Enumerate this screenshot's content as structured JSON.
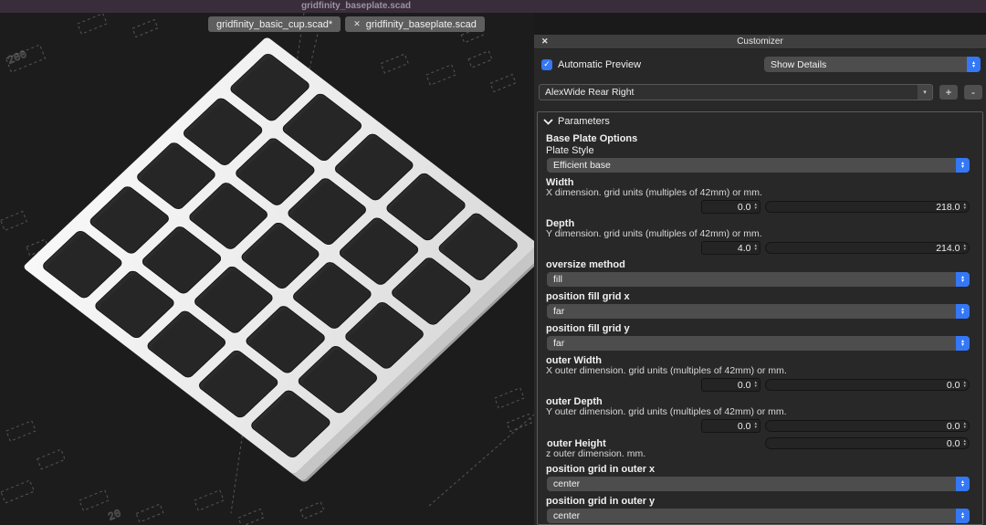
{
  "icons": {
    "close": "✕",
    "check": "✓",
    "chevron_up": "▴",
    "chevron_down": "▾"
  },
  "colors": {
    "accent_blue": "#3478f6",
    "titlebar_bg": "#3a2d3b",
    "panel_bg": "#282828",
    "viewport_bg": "#1c1c1c",
    "plate_white": "#ededed"
  },
  "titlebar": {
    "title": "gridfinity_baseplate.scad"
  },
  "tabs": [
    {
      "label": "gridfinity_basic_cup.scad*"
    },
    {
      "label": "gridfinity_baseplate.scad"
    }
  ],
  "viewport": {
    "grid_rows": 5,
    "grid_cols": 5
  },
  "customizer": {
    "title": "Customizer",
    "automatic_preview_label": "Automatic Preview",
    "details_dropdown_value": "Show Details",
    "preset_dropdown_value": "AlexWide Rear Right",
    "add_preset_label": "+",
    "remove_preset_label": "-",
    "parameters_label": "Parameters",
    "params": [
      {
        "type": "group",
        "text": "Base Plate Options"
      },
      {
        "type": "label",
        "text": "Plate Style"
      },
      {
        "type": "select",
        "value": "Efficient base"
      },
      {
        "type": "name",
        "text": "Width"
      },
      {
        "type": "desc",
        "text": "X dimension. grid units (multiples of 42mm) or mm."
      },
      {
        "type": "sliderrow",
        "spin": "0.0",
        "slider": "218.0"
      },
      {
        "type": "name",
        "text": "Depth"
      },
      {
        "type": "desc",
        "text": "Y dimension. grid units (multiples of 42mm) or mm."
      },
      {
        "type": "sliderrow",
        "spin": "4.0",
        "slider": "214.0"
      },
      {
        "type": "name",
        "text": "oversize method"
      },
      {
        "type": "select",
        "value": "fill"
      },
      {
        "type": "name",
        "text": "position fill grid x"
      },
      {
        "type": "select",
        "value": "far"
      },
      {
        "type": "name",
        "text": "position fill grid y"
      },
      {
        "type": "select",
        "value": "far"
      },
      {
        "type": "name",
        "text": "outer Width"
      },
      {
        "type": "desc",
        "text": "X outer dimension. grid units (multiples of 42mm) or mm."
      },
      {
        "type": "sliderrow",
        "spin": "0.0",
        "slider": "0.0"
      },
      {
        "type": "name",
        "text": "outer Depth"
      },
      {
        "type": "desc",
        "text": "Y outer dimension. grid units (multiples of 42mm) or mm."
      },
      {
        "type": "sliderrow",
        "spin": "0.0",
        "slider": "0.0"
      },
      {
        "type": "nameslider",
        "text": "outer Height",
        "slider": "0.0"
      },
      {
        "type": "desc",
        "text": "z outer dimension. mm."
      },
      {
        "type": "name",
        "text": "position grid in outer x"
      },
      {
        "type": "select",
        "value": "center"
      },
      {
        "type": "name",
        "text": "position grid in outer y"
      },
      {
        "type": "select",
        "value": "center"
      }
    ]
  }
}
